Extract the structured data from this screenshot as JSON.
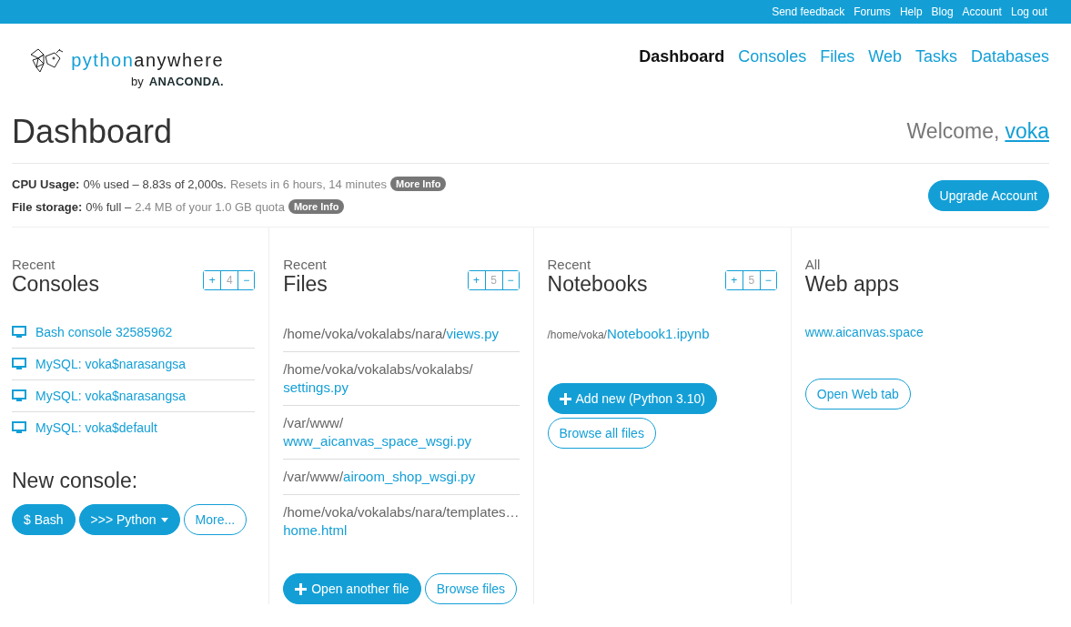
{
  "top_links": [
    "Send feedback",
    "Forums",
    "Help",
    "Blog",
    "Account",
    "Log out"
  ],
  "logo": {
    "brand_first": "python",
    "brand_second": "anywhere",
    "by": "by",
    "company": "ANACONDA."
  },
  "nav": [
    {
      "label": "Dashboard",
      "selected": true
    },
    {
      "label": "Consoles",
      "selected": false
    },
    {
      "label": "Files",
      "selected": false
    },
    {
      "label": "Web",
      "selected": false
    },
    {
      "label": "Tasks",
      "selected": false
    },
    {
      "label": "Databases",
      "selected": false
    }
  ],
  "page_title": "Dashboard",
  "welcome": {
    "text": "Welcome,",
    "user": "voka"
  },
  "usage": [
    {
      "label": "CPU Usage:",
      "value": "0% used – 8.83s of 2,000s.",
      "detail": "Resets in 6 hours, 14 minutes",
      "button": "More Info"
    },
    {
      "label": "File storage:",
      "value": "0% full –",
      "detail": "2.4 MB of your 1.0 GB quota",
      "button": "More Info"
    }
  ],
  "upgrade_button": "Upgrade Account",
  "panels": [
    {
      "overline": "Recent",
      "title": "Consoles",
      "counter": {
        "plus": "+",
        "count": "4",
        "minus": "−"
      },
      "items": [
        {
          "kind": "console",
          "label": "Bash console 32585962"
        },
        {
          "kind": "console",
          "label": "MySQL: voka$narasangsa"
        },
        {
          "kind": "console",
          "label": "MySQL: voka$narasangsa"
        },
        {
          "kind": "console",
          "label": "MySQL: voka$default"
        }
      ],
      "subheading": "New console:",
      "buttons": [
        {
          "label": "$ Bash",
          "kind": "primary",
          "plus": false,
          "dropdown": false
        },
        {
          "label": ">>> Python",
          "kind": "primary",
          "plus": false,
          "dropdown": true
        },
        {
          "label": "More...",
          "kind": "outline",
          "plus": false,
          "dropdown": false
        }
      ]
    },
    {
      "overline": "Recent",
      "title": "Files",
      "counter": {
        "plus": "+",
        "count": "5",
        "minus": "−"
      },
      "items": [
        {
          "kind": "file",
          "path": "/home/voka/vokalabs/nara/",
          "name": "views.py"
        },
        {
          "kind": "file",
          "path": "/home/voka/vokalabs/vokalabs/",
          "name": "settings.py"
        },
        {
          "kind": "file",
          "path": "/var/www/",
          "name": "www_aicanvas_space_wsgi.py"
        },
        {
          "kind": "file",
          "path": "/var/www/",
          "name": "airoom_shop_wsgi.py"
        },
        {
          "kind": "file",
          "path": "/home/voka/vokalabs/nara/templates…",
          "name": "home.html"
        }
      ],
      "buttons": [
        {
          "label": "Open another file",
          "kind": "primary",
          "plus": true,
          "dropdown": false
        },
        {
          "label": "Browse files",
          "kind": "outline",
          "plus": false,
          "dropdown": false
        }
      ]
    },
    {
      "overline": "Recent",
      "title": "Notebooks",
      "counter": {
        "plus": "+",
        "count": "5",
        "minus": "−"
      },
      "items": [
        {
          "kind": "notebook",
          "path": "/home/voka/",
          "name": "Notebook1.ipynb"
        }
      ],
      "buttons": [
        {
          "label": "Add new (Python 3.10)",
          "kind": "primary",
          "plus": true,
          "dropdown": false
        },
        {
          "label": "Browse all files",
          "kind": "outline",
          "plus": false,
          "dropdown": false
        }
      ]
    },
    {
      "overline": "All",
      "title": "Web apps",
      "items": [
        {
          "kind": "webapp",
          "label": "www.aicanvas.space"
        }
      ],
      "buttons": [
        {
          "label": "Open Web tab",
          "kind": "outline",
          "plus": false,
          "dropdown": false
        }
      ]
    }
  ]
}
